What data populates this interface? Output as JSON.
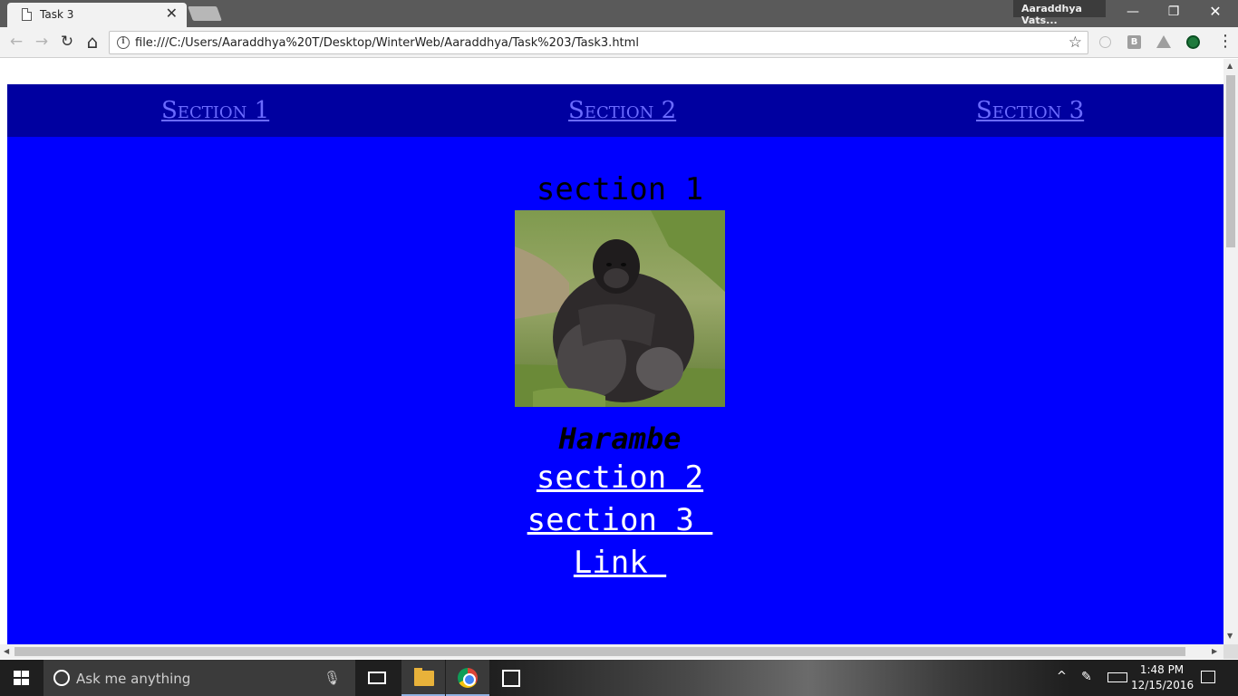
{
  "browser": {
    "tab_title": "Task 3",
    "tab_close": "✕",
    "profile_name": "Aaraddhya Vats...",
    "url": "file:///C:/Users/Aaraddhya%20T/Desktop/WinterWeb/Aaraddhya/Task%203/Task3.html",
    "window": {
      "minimize": "—",
      "restore": "❐",
      "close": "✕"
    },
    "nav": {
      "back": "←",
      "forward": "→",
      "reload": "↻",
      "home": "⌂",
      "bookmark_star": "☆"
    },
    "extensions": [
      "circle-extension-icon",
      "b-extension-icon",
      "drive-icon",
      "green-circle-extension-icon",
      "menu-icon"
    ],
    "ext_b_label": "B",
    "menu_glyph": "⋮"
  },
  "page": {
    "nav_links": [
      "Section 1",
      "Section 2",
      "Section 3"
    ],
    "section": {
      "heading": "section 1",
      "image_subject": "gorilla photo",
      "caption": "Harambe",
      "links": [
        "section 2",
        "section 3 ",
        "Link "
      ]
    },
    "colors": {
      "nav_bg": "#0000a0",
      "section_bg": "#0000ff",
      "nav_link": "#6b6bff",
      "link": "#ffffff"
    }
  },
  "taskbar": {
    "search_placeholder": "Ask me anything",
    "time": "1:48 PM",
    "date": "12/15/2016",
    "tray_chevron": "^"
  }
}
